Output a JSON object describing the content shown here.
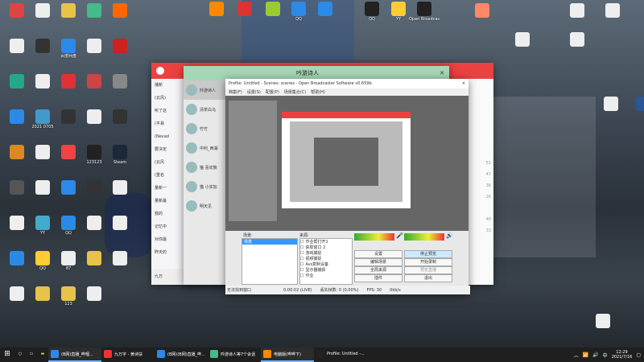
{
  "desktop": {
    "icons_left": [
      {
        "label": "",
        "color": "#d44"
      },
      {
        "label": "",
        "color": "#eee"
      },
      {
        "label": "",
        "color": "#e8c34a"
      },
      {
        "label": "",
        "color": "#4b8"
      },
      {
        "label": "",
        "color": "#f60"
      },
      {
        "label": "",
        "color": "#eee"
      },
      {
        "label": "",
        "color": "#333"
      },
      {
        "label": "百度网盘",
        "color": "#2b8ae8"
      },
      {
        "label": "",
        "color": "#eee"
      },
      {
        "label": "",
        "color": "#c22"
      },
      {
        "label": "",
        "color": "#2a8"
      },
      {
        "label": "",
        "color": "#eee"
      },
      {
        "label": "",
        "color": "#d33"
      },
      {
        "label": "",
        "color": "#c44"
      },
      {
        "label": "",
        "color": "#888"
      },
      {
        "label": "",
        "color": "#2b8ae8"
      },
      {
        "label": "2021 0705",
        "color": "#49c"
      },
      {
        "label": "",
        "color": "#333"
      },
      {
        "label": "",
        "color": "#eee"
      },
      {
        "label": "",
        "color": "#333"
      },
      {
        "label": "",
        "color": "#d82"
      },
      {
        "label": "",
        "color": "#eee"
      },
      {
        "label": "",
        "color": "#e44"
      },
      {
        "label": "123123",
        "color": "#222"
      },
      {
        "label": "Steam",
        "color": "#1b2838"
      },
      {
        "label": "",
        "color": "#555"
      },
      {
        "label": "",
        "color": "#eee"
      },
      {
        "label": "",
        "color": "#2b8ae8"
      },
      {
        "label": "",
        "color": "#333"
      },
      {
        "label": "",
        "color": "#eee"
      },
      {
        "label": "",
        "color": "#eee"
      },
      {
        "label": "YY",
        "color": "#4ac"
      },
      {
        "label": "QQ",
        "color": "#2b8ae8"
      },
      {
        "label": "",
        "color": "#eee"
      },
      {
        "label": "",
        "color": "#eee"
      },
      {
        "label": "",
        "color": "#2b8ae8"
      },
      {
        "label": "QQ",
        "color": "#fc3"
      },
      {
        "label": "87",
        "color": "#eee"
      },
      {
        "label": "",
        "color": "#e8c34a"
      },
      {
        "label": "",
        "color": "#eee"
      },
      {
        "label": "",
        "color": "#eee"
      },
      {
        "label": "",
        "color": "#e8c34a"
      },
      {
        "label": "123",
        "color": "#e8c34a"
      },
      {
        "label": "",
        "color": "#eee"
      }
    ],
    "icons_top": [
      {
        "label": "",
        "color": "#f80"
      },
      {
        "label": "",
        "color": "#d33"
      },
      {
        "label": "",
        "color": "#9c3"
      },
      {
        "label": "QQ",
        "color": "#2b8ae8"
      },
      {
        "label": "",
        "color": "#2b8ae8"
      },
      {
        "label": "QQ",
        "color": "#222"
      },
      {
        "label": "YY",
        "color": "#fc3"
      },
      {
        "label": "Open Broadcaster",
        "color": "#222"
      }
    ],
    "icons_right": [
      {
        "label": "",
        "color": "#f86"
      },
      {
        "label": "",
        "color": "#eee"
      },
      {
        "label": "",
        "color": "#eee"
      },
      {
        "label": "",
        "color": "#eee"
      },
      {
        "label": "",
        "color": "#eee"
      },
      {
        "label": "",
        "color": "#eee"
      },
      {
        "label": "",
        "color": "#2b5797"
      },
      {
        "label": "",
        "color": "#eee"
      }
    ]
  },
  "netease": {
    "title_icon": "netease-logo-icon",
    "sidebar": [
      "播新",
      "(云风)",
      "听了这",
      "(平易",
      "(Nevad",
      "要决定",
      "(云风",
      "(重名",
      "量新一",
      "量新最",
      "我的",
      "记忆中",
      "对你最",
      "昨天的"
    ],
    "right_col": [
      "",
      "",
      "",
      "",
      "",
      "",
      "",
      "51",
      "47",
      "36",
      "26",
      "",
      "48",
      "33"
    ],
    "bottom_text": "九万"
  },
  "chat": {
    "title": "吟游诗人",
    "contacts": [
      "吟游诗人",
      "清茶白乌",
      "竹竹",
      "中利_西湖",
      "猫 喜欢熊",
      "猫 小实加",
      "明天见"
    ]
  },
  "obs": {
    "title": "Profile: Untitled - Scenes: scenes - Open Broadcaster Software v0.659b",
    "menu": [
      "档案(F)",
      "设置(S)",
      "配置(P)",
      "场景集合(C)",
      "帮助(H)"
    ],
    "scenes_label": "场景:",
    "scene_item": "场景",
    "sources_label": "来源:",
    "sources": [
      "作业帮打开1",
      "获取窗口 2",
      "游戏捕捉",
      "视频捕捉",
      "Avs复制设备",
      "显示器捕获",
      "作业"
    ],
    "buttons": {
      "settings": "设置",
      "stop_preview": "停止预览",
      "edit_scene": "编辑场景",
      "start_record": "开始录制",
      "global_sources": "全局来源",
      "preview_stream": "预览直播",
      "plugins": "插件",
      "exit": "退出"
    },
    "status": {
      "window_text": "无法找到窗口",
      "time": "0:00:02 (LIVE)",
      "dropped": "丢失帧数: 0 (0.00%)",
      "fps": "FPS: 30",
      "kbps": "0kb/s"
    }
  },
  "taskbar": {
    "buttons": [
      {
        "label": "(B网)直播_哔哩...",
        "color": "#2b8ae8",
        "active": true
      },
      {
        "label": "九万字 - 黄诗扶",
        "color": "#e33",
        "active": false
      },
      {
        "label": "(B网)(B网)直播_哔...",
        "color": "#2b8ae8",
        "active": false
      },
      {
        "label": "吟游诗人等7个会话",
        "color": "#4b8",
        "active": false
      },
      {
        "label": "电脑版(哔哔下)",
        "color": "#f80",
        "active": true
      },
      {
        "label": "Profile: Untitled -...",
        "color": "#222",
        "active": false
      }
    ],
    "time": "12:29",
    "date": "2021/7/16",
    "lang": "中"
  }
}
